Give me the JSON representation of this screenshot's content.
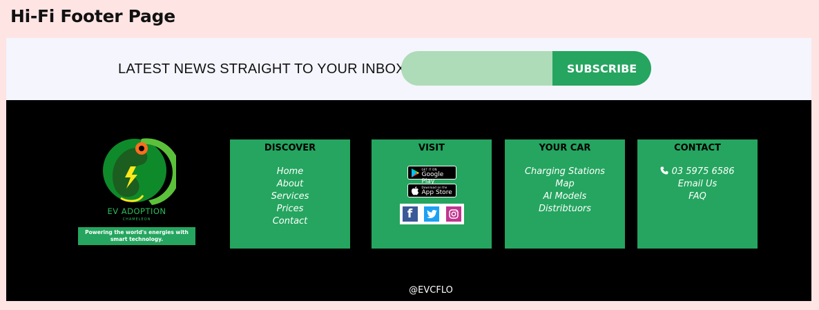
{
  "page": {
    "title": "Hi-Fi Footer Page"
  },
  "newsletter": {
    "text": "LATEST NEWS STRAIGHT TO YOUR INBOX",
    "email_placeholder": "",
    "subscribe_label": "SUBSCRIBE"
  },
  "brand": {
    "name": "EV ADOPTION",
    "sub": "CHAMELEON",
    "tagline": "Powering the world's energies with smart technology."
  },
  "discover": {
    "heading": "DISCOVER",
    "links": [
      "Home",
      "About",
      "Services",
      "Prices",
      "Contact"
    ]
  },
  "visit": {
    "heading": "VISIT",
    "google_play": {
      "small": "GET IT ON",
      "big": "Google Play"
    },
    "app_store": {
      "small": "Download on the",
      "big": "App Store"
    },
    "social": [
      "facebook",
      "twitter",
      "instagram"
    ]
  },
  "your_car": {
    "heading": "YOUR CAR",
    "links": [
      "Charging Stations",
      "Map",
      "AI Models",
      "Distribtuors"
    ]
  },
  "contact": {
    "heading": "CONTACT",
    "phone": "03 5975 6586",
    "email": "Email Us",
    "faq": "FAQ"
  },
  "footer": {
    "copyright": "@EVCFLO"
  },
  "colors": {
    "accent": "#25a55f",
    "input": "#aedbb8",
    "band": "#f4f5fd",
    "bg": "#ffe4e4",
    "footer_bg": "#000000"
  },
  "icons": [
    "phone-icon",
    "google-play-icon",
    "apple-icon",
    "facebook-icon",
    "twitter-icon",
    "instagram-icon",
    "chameleon-logo"
  ]
}
